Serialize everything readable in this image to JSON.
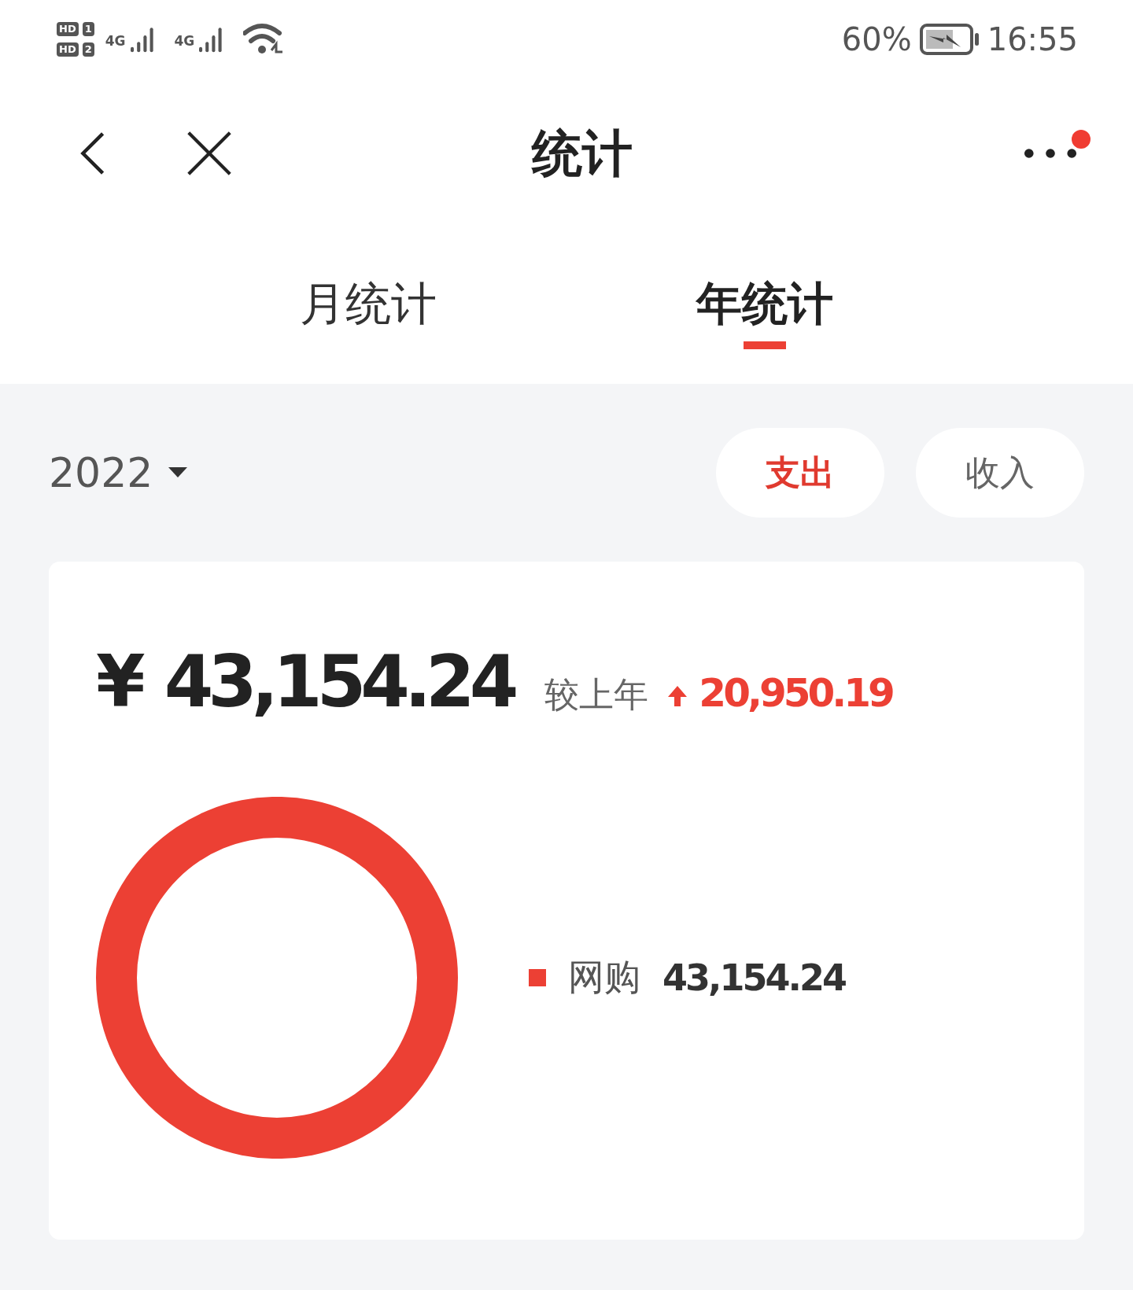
{
  "status_bar": {
    "sims": [
      {
        "hd": "HD",
        "slot": "1"
      },
      {
        "hd": "HD",
        "slot": "2"
      }
    ],
    "networks": [
      "4G",
      "4G"
    ],
    "battery": "60%",
    "time": "16:55"
  },
  "header": {
    "title": "统计",
    "more_dot": true
  },
  "tabs": [
    {
      "label": "月统计",
      "selected": false
    },
    {
      "label": "年统计",
      "selected": true
    }
  ],
  "year": "2022",
  "type_buttons": [
    {
      "label": "支出",
      "selected": true
    },
    {
      "label": "收入",
      "selected": false
    }
  ],
  "summary": {
    "currency": "¥",
    "total": "43,154.24",
    "compare_label": "较上年",
    "change": "20,950.19"
  },
  "legend": [
    {
      "label": "网购",
      "value": "43,154.24",
      "color": "#ec4034"
    }
  ]
}
